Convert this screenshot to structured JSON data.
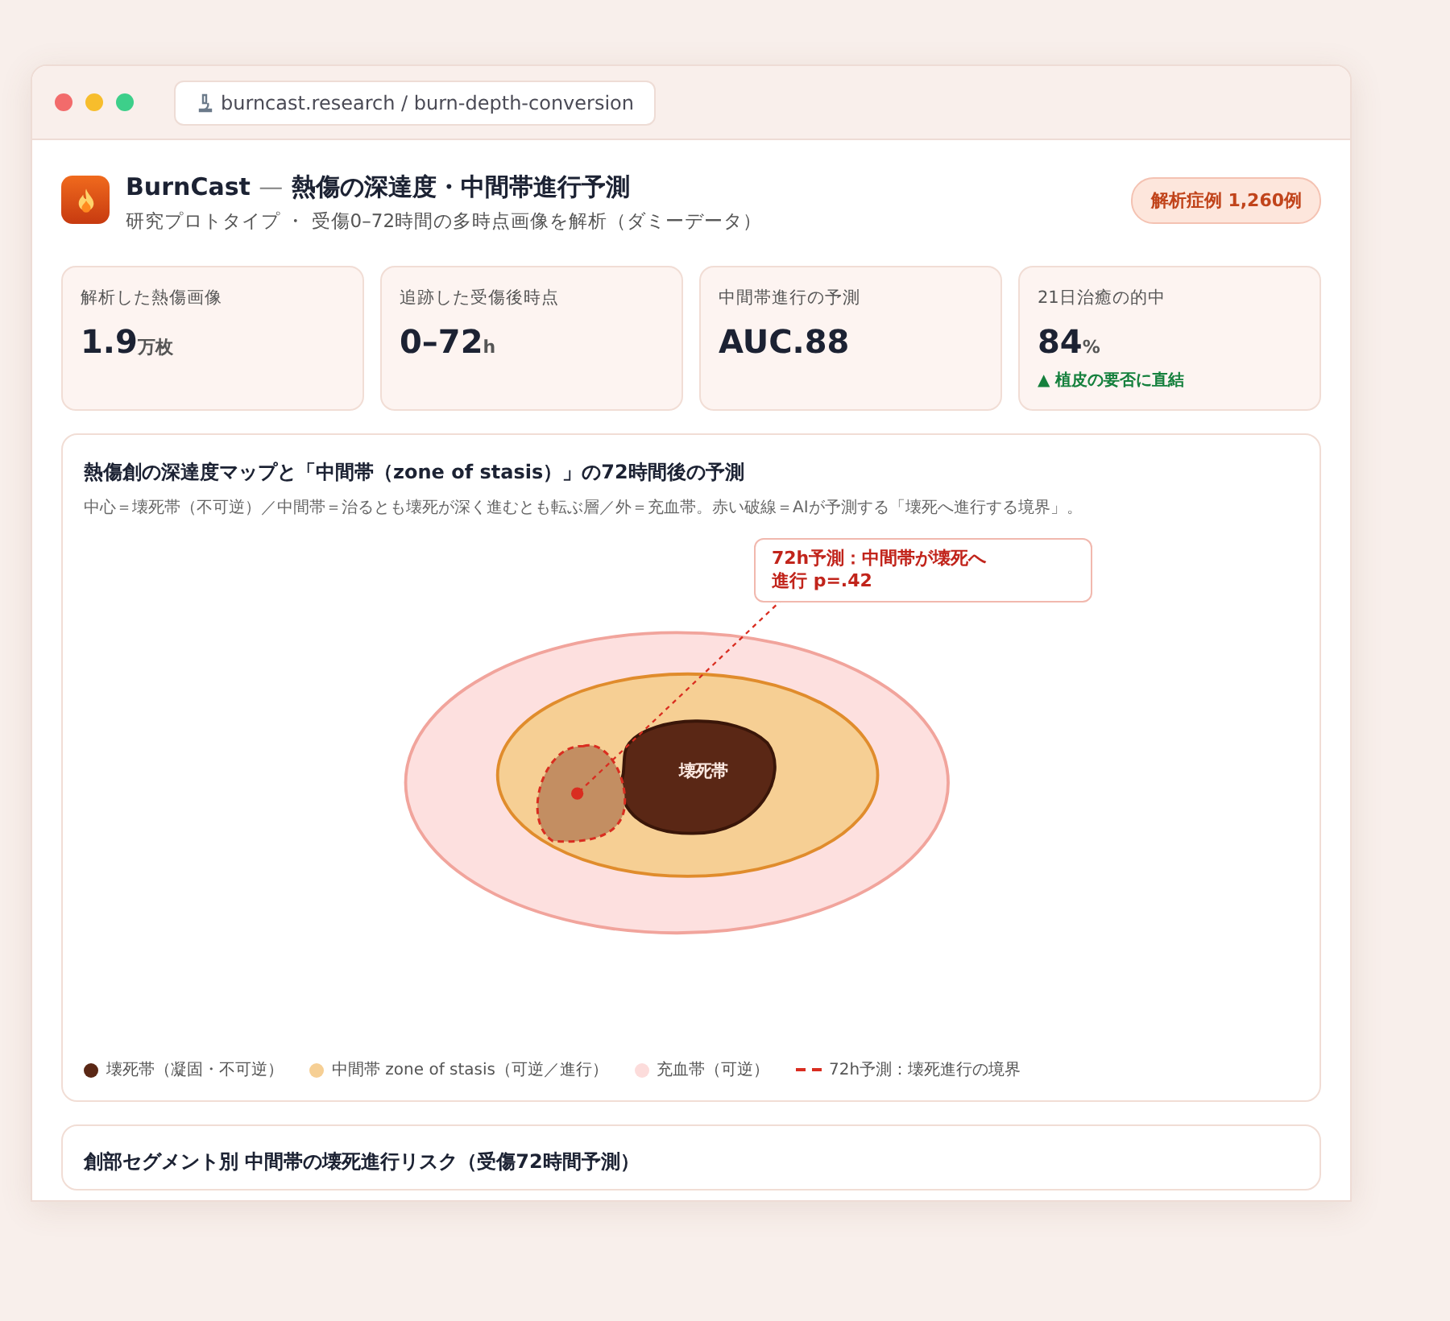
{
  "window": {
    "url": "burncast.research / burn-depth-conversion"
  },
  "header": {
    "brand": "BurnCast",
    "separator": "—",
    "title": "熱傷の深達度・中間帯進行予測",
    "subtitle": "研究プロトタイプ ・ 受傷0–72時間の多時点画像を解析（ダミーデータ）",
    "badge": "解析症例 1,260例"
  },
  "stats": [
    {
      "label": "解析した熱傷画像",
      "value": "1.9",
      "unit": "万枚"
    },
    {
      "label": "追跡した受傷後時点",
      "value": "0–72",
      "unit": "h"
    },
    {
      "label": "中間帯進行の予測",
      "value": "AUC.88"
    },
    {
      "label": "21日治癒の的中",
      "value": "84",
      "unit": "%",
      "note": "▲ 植皮の要否に直結"
    }
  ],
  "map_card": {
    "title": "熱傷創の深達度マップと「中間帯（zone of stasis）」の72時間後の予測",
    "description": "中心＝壊死帯（不可逆）／中間帯＝治るとも壊死が深く進むとも転ぶ層／外＝充血帯。赤い破線＝AIが予測する「壊死へ進行する境界」。",
    "callout": [
      "72h予測：中間帯が壊死へ",
      "進行 p=.42"
    ],
    "zone_label": "壊死帯",
    "legend": [
      {
        "kind": "dot",
        "color": "#5a2715",
        "label": "壊死帯（凝固・不可逆）"
      },
      {
        "kind": "dot",
        "color": "#f6cf94",
        "label": "中間帯 zone of stasis（可逆／進行）"
      },
      {
        "kind": "dot",
        "color": "#fcdcdb",
        "label": "充血帯（可逆）"
      },
      {
        "kind": "dash",
        "color": "#d92d20",
        "label": "72h予測：壊死進行の境界"
      }
    ]
  },
  "segment_card": {
    "title": "創部セグメント別 中間帯の壊死進行リスク（受傷72時間予測）"
  }
}
